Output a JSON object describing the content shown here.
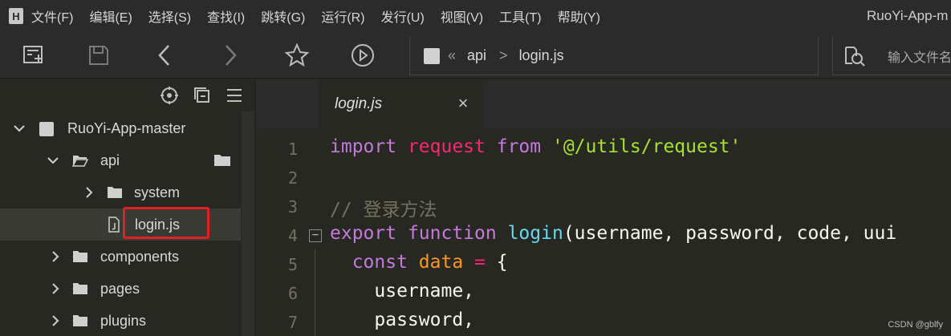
{
  "menubar": {
    "logo": "H",
    "items": [
      "文件(F)",
      "编辑(E)",
      "选择(S)",
      "查找(I)",
      "跳转(G)",
      "运行(R)",
      "发行(U)",
      "视图(V)",
      "工具(T)",
      "帮助(Y)"
    ],
    "window_title": "RuoYi-App-m"
  },
  "toolbar": {
    "breadcrumb": [
      "api",
      "login.js"
    ],
    "breadcrumb_sep": "«",
    "breadcrumb_chev": ">",
    "search_placeholder": "输入文件名"
  },
  "sidebar": {
    "tree": [
      {
        "label": "RuoYi-App-master",
        "type": "project",
        "expanded": true
      },
      {
        "label": "api",
        "type": "folder",
        "expanded": true
      },
      {
        "label": "system",
        "type": "folder",
        "expanded": false
      },
      {
        "label": "login.js",
        "type": "file",
        "selected": true
      },
      {
        "label": "components",
        "type": "folder",
        "expanded": false
      },
      {
        "label": "pages",
        "type": "folder",
        "expanded": false
      },
      {
        "label": "plugins",
        "type": "folder",
        "expanded": false
      }
    ]
  },
  "editor": {
    "tab_label": "login.js",
    "close_glyph": "×",
    "fold_glyph": "−",
    "lines": [
      {
        "n": "1",
        "tokens": [
          [
            "kw",
            "import "
          ],
          [
            "kw2",
            "request "
          ],
          [
            "kw",
            "from "
          ],
          [
            "str",
            "'@/utils/request'"
          ]
        ]
      },
      {
        "n": "2",
        "tokens": []
      },
      {
        "n": "3",
        "tokens": [
          [
            "com",
            "// 登录方法"
          ]
        ]
      },
      {
        "n": "4",
        "tokens": [
          [
            "kw",
            "export "
          ],
          [
            "kw",
            "function "
          ],
          [
            "fn",
            "login"
          ],
          [
            "",
            "(username, password, code, uui"
          ]
        ]
      },
      {
        "n": "5",
        "tokens": [
          [
            "",
            "  "
          ],
          [
            "kw",
            "const "
          ],
          [
            "var",
            "data "
          ],
          [
            "kw2",
            "= "
          ],
          [
            "",
            "{"
          ]
        ]
      },
      {
        "n": "6",
        "tokens": [
          [
            "",
            "    username,"
          ]
        ]
      },
      {
        "n": "7",
        "tokens": [
          [
            "",
            "    password,"
          ]
        ]
      }
    ]
  },
  "watermark": "CSDN @gblfy",
  "colors": {
    "background": "#272822",
    "chrome": "#2b2b2b",
    "highlight": "#e02020",
    "keyword": "#c678dd",
    "string": "#a6e22e",
    "comment": "#75715e",
    "function": "#66d9ef"
  }
}
